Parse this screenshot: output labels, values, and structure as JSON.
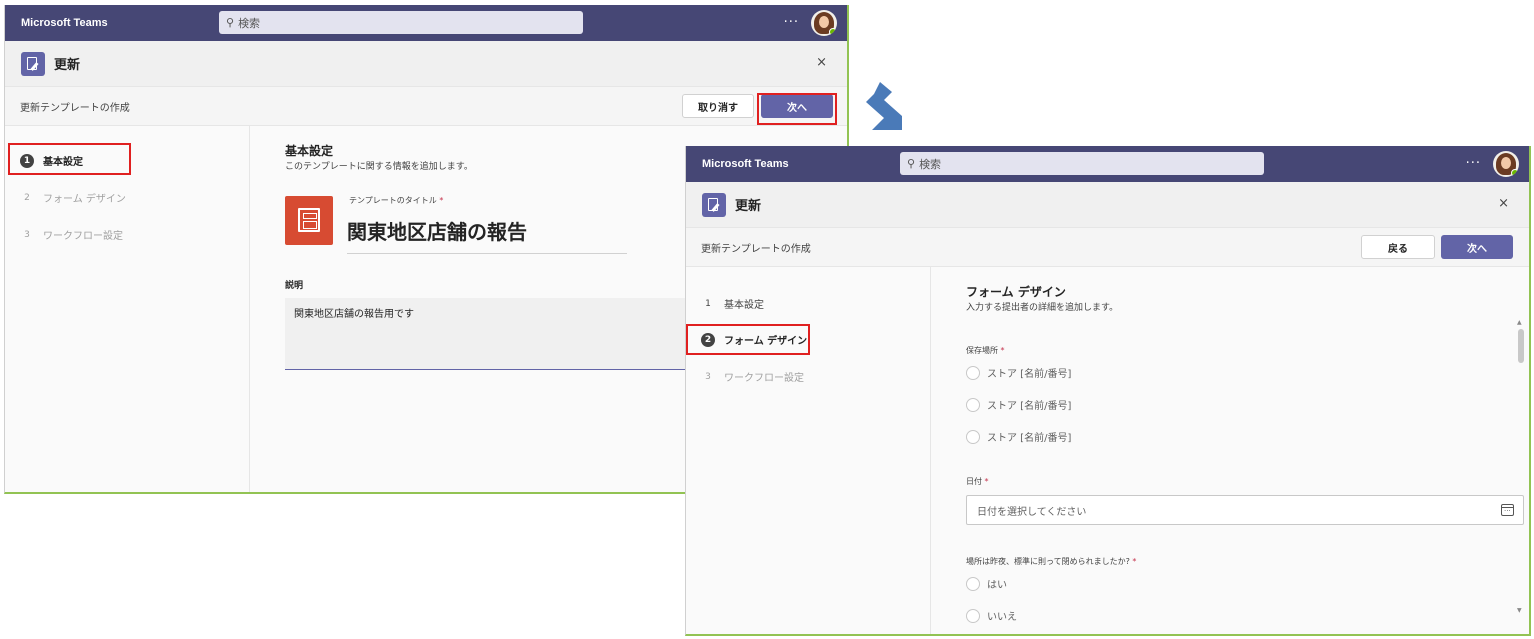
{
  "colors": {
    "titlebar": "#464775",
    "accent": "#6264a7",
    "highlight": "#e02020",
    "template_icon": "#d74b32",
    "arrow": "#4a7ab8"
  },
  "left": {
    "app_name": "Microsoft Teams",
    "search_placeholder": "検索",
    "more": "···",
    "header_title": "更新",
    "close": "×",
    "subtitle": "更新テンプレートの作成",
    "cancel_label": "取り消す",
    "next_label": "次へ",
    "steps": [
      {
        "num": "1",
        "label": "基本設定",
        "state": "active"
      },
      {
        "num": "2",
        "label": "フォーム デザイン",
        "state": "todo"
      },
      {
        "num": "3",
        "label": "ワークフロー設定",
        "state": "todo"
      }
    ],
    "section_title": "基本設定",
    "section_desc": "このテンプレートに関する情報を追加します。",
    "template_title_label": "テンプレートのタイトル",
    "required_mark": "*",
    "template_title": "関東地区店舗の報告",
    "description_label": "説明",
    "description_value": "関東地区店舗の報告用です"
  },
  "right": {
    "app_name": "Microsoft Teams",
    "search_placeholder": "検索",
    "more": "···",
    "header_title": "更新",
    "close": "×",
    "subtitle": "更新テンプレートの作成",
    "back_label": "戻る",
    "next_label": "次へ",
    "steps": [
      {
        "num": "1",
        "label": "基本設定",
        "state": "done"
      },
      {
        "num": "2",
        "label": "フォーム デザイン",
        "state": "active"
      },
      {
        "num": "3",
        "label": "ワークフロー設定",
        "state": "todo"
      }
    ],
    "section_title": "フォーム デザイン",
    "section_desc": "入力する提出者の詳細を追加します。",
    "storage_label": "保存場所",
    "required_mark": "*",
    "store_options": [
      "ストア [名前/番号]",
      "ストア [名前/番号]",
      "ストア [名前/番号]"
    ],
    "date_label": "日付",
    "date_placeholder": "日付を選択してください",
    "question_label": "場所は昨夜、標準に則って閉められましたか?",
    "answer_options": [
      "はい",
      "いいえ"
    ],
    "scroll_up": "▲",
    "scroll_down": "▼"
  }
}
